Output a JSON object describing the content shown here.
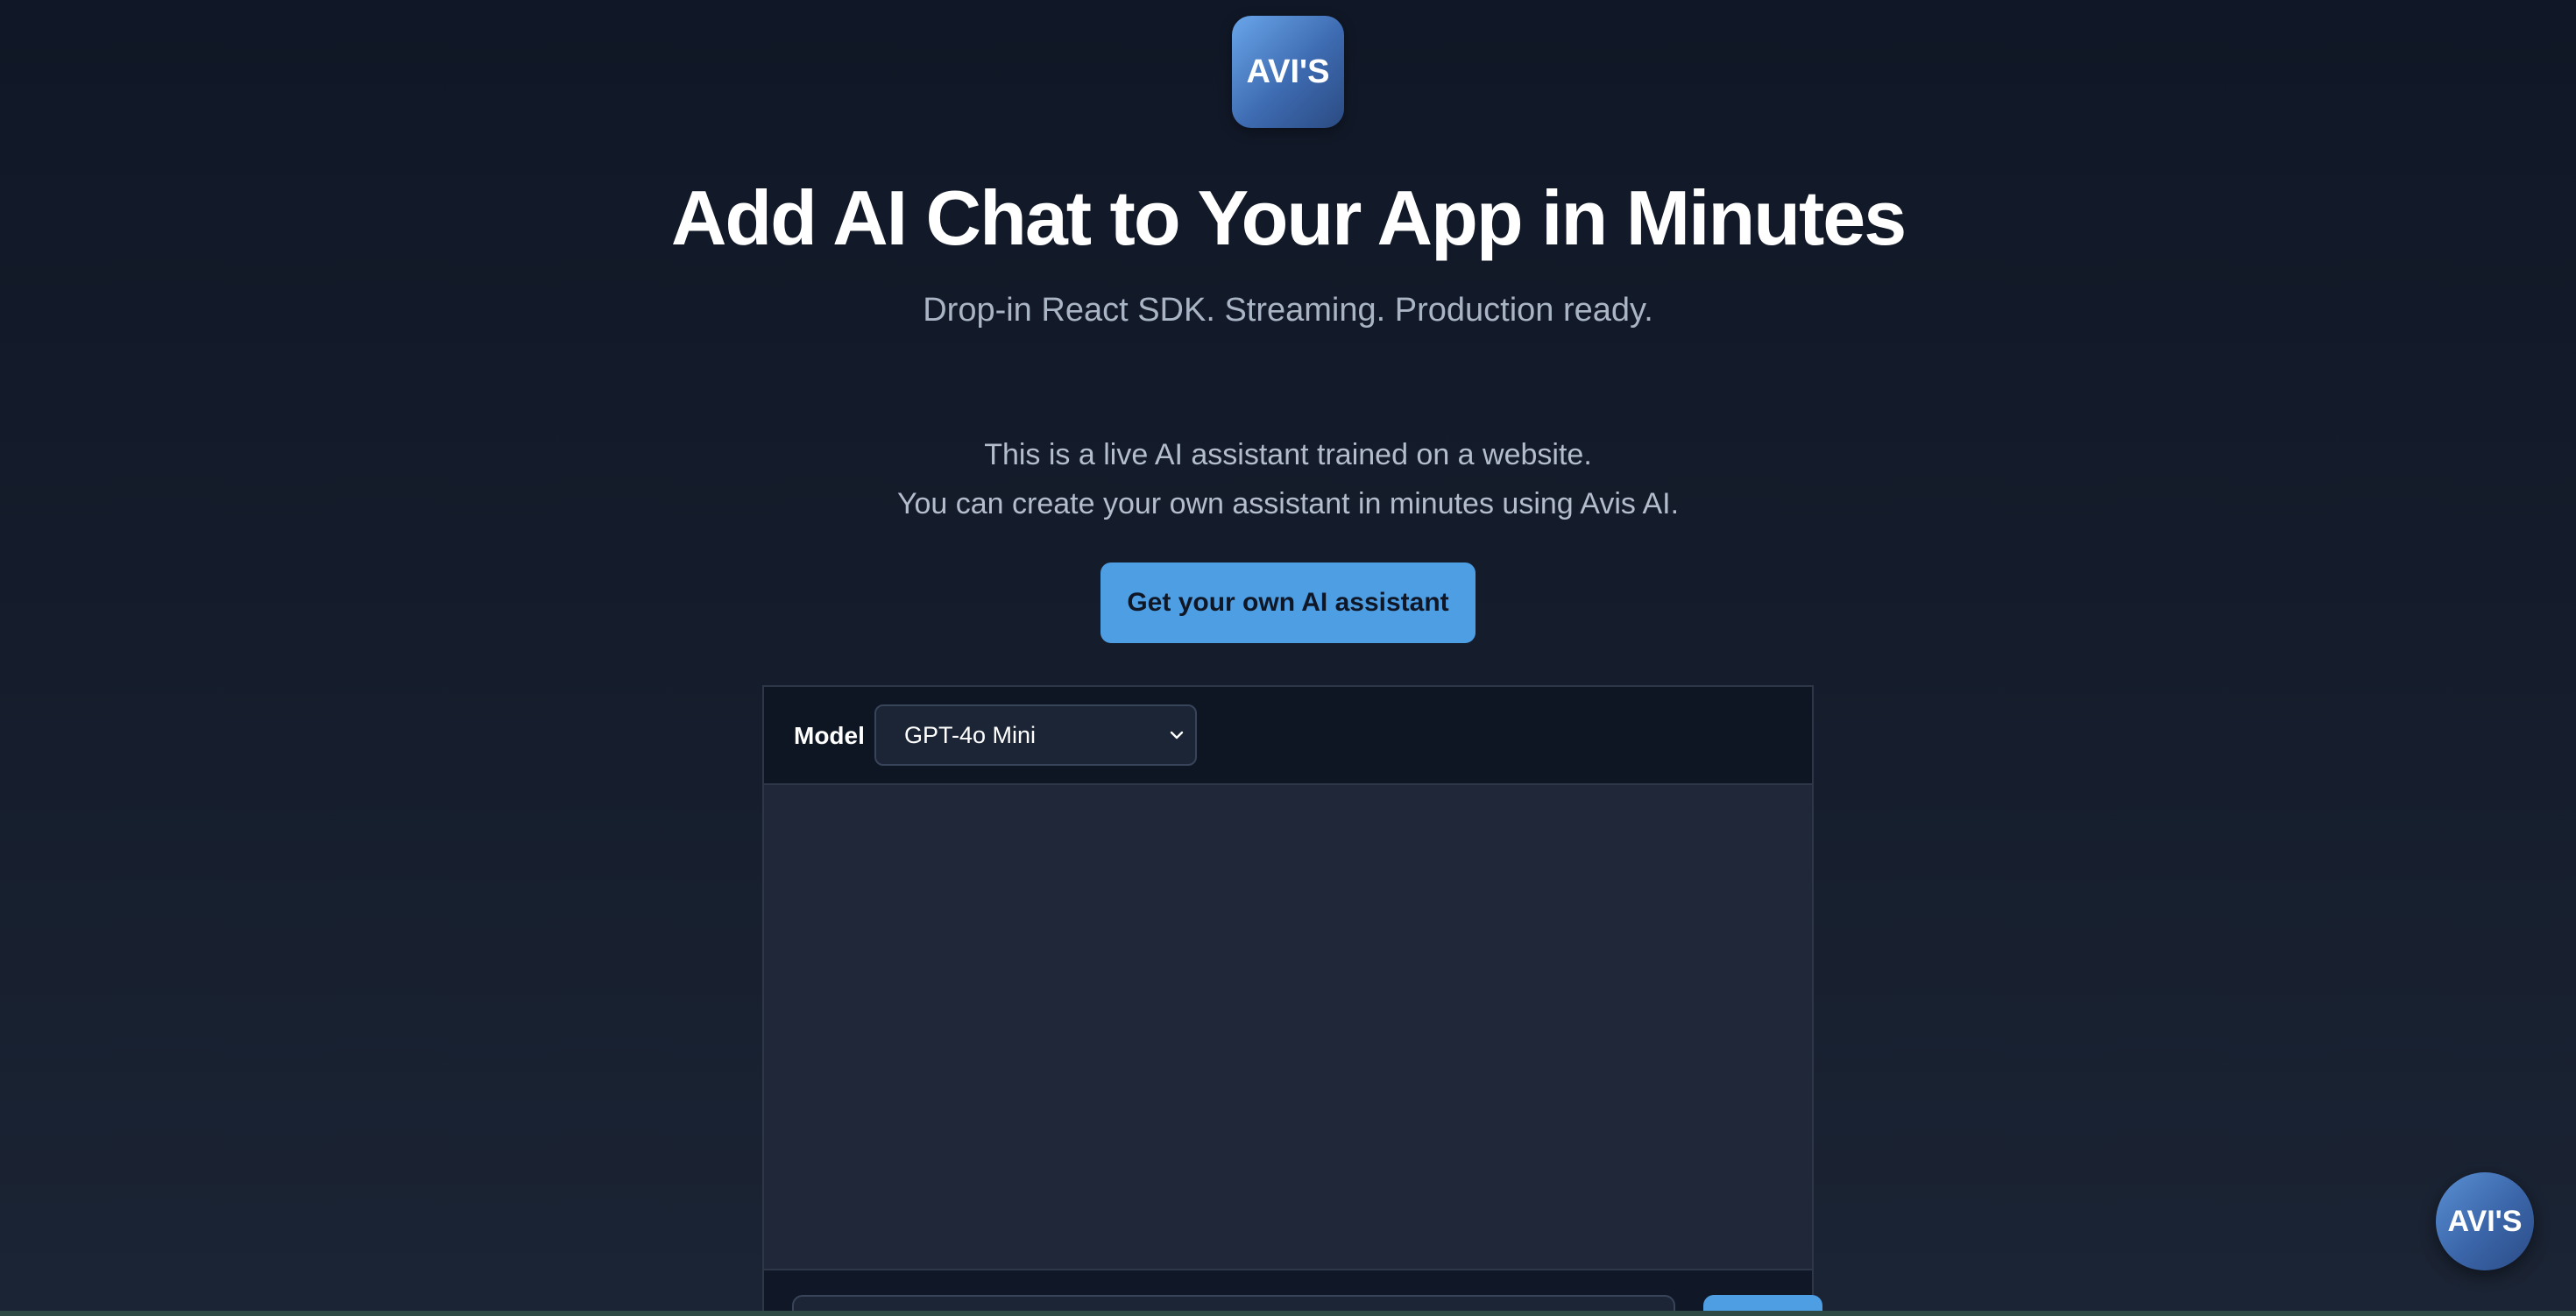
{
  "brand": {
    "logo_text": "AVI'S"
  },
  "hero": {
    "title": "Add AI Chat to Your App in Minutes",
    "subtitle": "Drop-in React SDK. Streaming. Production ready."
  },
  "intro": {
    "line1": "This is a live AI assistant trained on a website.",
    "line2": "You can create your own assistant in minutes using Avis AI."
  },
  "cta": {
    "label": "Get your own AI assistant"
  },
  "chat": {
    "model_label": "Model",
    "model_selected": "GPT-4o Mini",
    "icons": {
      "model_dropdown": "chevron-down-icon"
    }
  },
  "fab": {
    "label": "AVI'S"
  },
  "colors": {
    "accent": "#4d9ee3",
    "background_top": "#101726",
    "background_bottom": "#1b2434",
    "panel": "#1f2738",
    "panel_header": "#0e1523"
  }
}
